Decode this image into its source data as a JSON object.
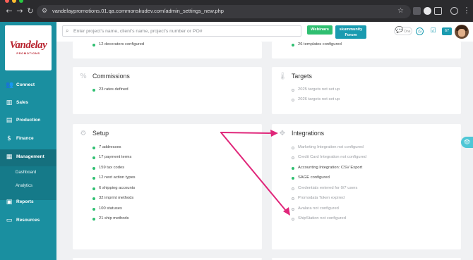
{
  "browser": {
    "url": "vandelaypromotions.01.qa.commonskudev.com/admin_settings_new.php",
    "traffic_light_colors": [
      "#ff5f57",
      "#febc2e",
      "#28c840"
    ]
  },
  "sidebar": {
    "logo": {
      "name": "Vandelay",
      "subtitle": "PROMOTIONS"
    },
    "items": [
      {
        "label": "Connect",
        "icon": "users-icon"
      },
      {
        "label": "Sales",
        "icon": "bar-chart-icon"
      },
      {
        "label": "Production",
        "icon": "clipboard-icon"
      },
      {
        "label": "Finance",
        "icon": "dollar-icon"
      },
      {
        "label": "Management",
        "icon": "building-icon"
      },
      {
        "label": "Reports",
        "icon": "report-icon"
      },
      {
        "label": "Resources",
        "icon": "book-icon"
      }
    ],
    "sub_items": [
      "Dashboard",
      "Analytics"
    ],
    "accent_color": "#1a8fa0"
  },
  "topbar": {
    "search_placeholder": "Enter project's name, client's name, project's number or PO#",
    "webinars_label": "Webinars",
    "forum_label_line1": "skummunity",
    "forum_label_line2": "Forum",
    "one_label": "One",
    "notification_count": "67"
  },
  "cards": {
    "decorators": {
      "items": [
        {
          "text": "12 decorators configured",
          "status": "ok"
        }
      ]
    },
    "templates": {
      "items": [
        {
          "text": "26 templates configured",
          "status": "ok"
        }
      ]
    },
    "commissions": {
      "title": "Commissions",
      "items": [
        {
          "text": "23 rates defined",
          "status": "ok"
        }
      ]
    },
    "targets": {
      "title": "Targets",
      "items": [
        {
          "text": "2025 targets not set up",
          "status": "off"
        },
        {
          "text": "2026 targets not set up",
          "status": "off"
        }
      ]
    },
    "setup": {
      "title": "Setup",
      "items": [
        {
          "text": "7 addresses",
          "status": "ok"
        },
        {
          "text": "17 payment terms",
          "status": "ok"
        },
        {
          "text": "159 tax codes",
          "status": "ok"
        },
        {
          "text": "12 next action types",
          "status": "ok"
        },
        {
          "text": "6 shipping accounts",
          "status": "ok"
        },
        {
          "text": "32 imprint methods",
          "status": "ok"
        },
        {
          "text": "100 statuses",
          "status": "ok"
        },
        {
          "text": "21 ship methods",
          "status": "ok"
        }
      ]
    },
    "integrations": {
      "title": "Integrations",
      "items": [
        {
          "text": "Marketing Integration not configured",
          "status": "off"
        },
        {
          "text": "Credit Card Integration not configured",
          "status": "off"
        },
        {
          "text": "Accounting Integration: CSV Export",
          "status": "ok"
        },
        {
          "text": "SAGE configured",
          "status": "ok"
        },
        {
          "text": "Credentials entered for 0/7 users",
          "status": "off"
        },
        {
          "text": "Promodata Token expired",
          "status": "off"
        },
        {
          "text": "Avalara not configured",
          "status": "off"
        },
        {
          "text": "ShipStation not configured",
          "status": "off"
        }
      ]
    }
  },
  "annotation_color": "#e0267a"
}
